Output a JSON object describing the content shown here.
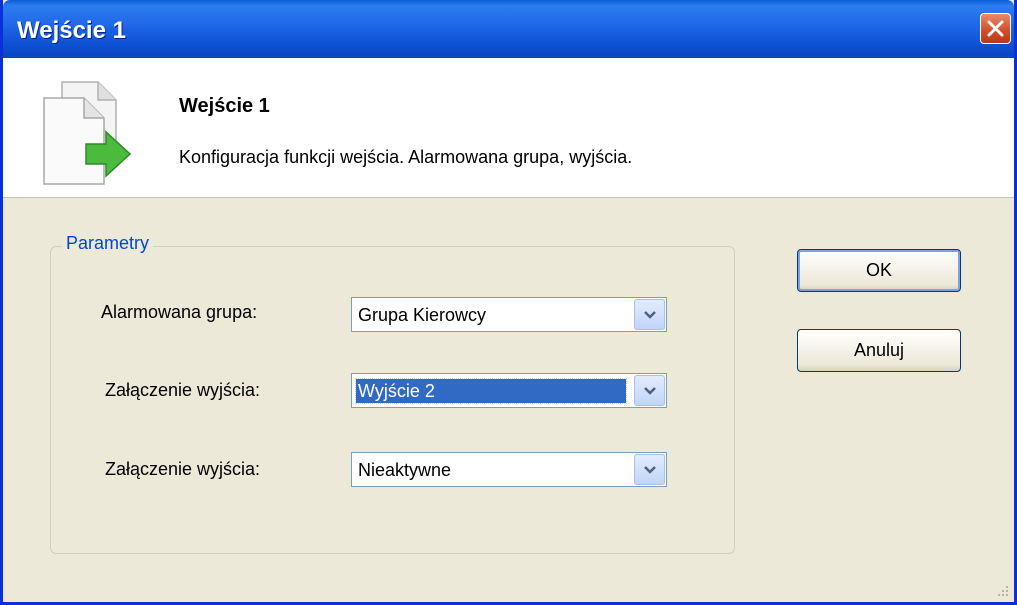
{
  "window": {
    "title": "Wejście 1"
  },
  "header": {
    "title": "Wejście 1",
    "description": "Konfiguracja funkcji wejścia. Alarmowana grupa, wyjścia."
  },
  "params": {
    "legend": "Parametry",
    "rows": [
      {
        "label": "Alarmowana grupa:",
        "value": "Grupa Kierowcy"
      },
      {
        "label": "Załączenie wyjścia:",
        "value": "Wyjście 2"
      },
      {
        "label": "Załączenie wyjścia:",
        "value": "Nieaktywne"
      }
    ]
  },
  "buttons": {
    "ok": "OK",
    "cancel": "Anuluj"
  },
  "colors": {
    "titlebar": "#1e66e6",
    "close": "#d24a25",
    "selection": "#316ac5",
    "legend": "#0046d5",
    "face": "#ece9d8"
  }
}
